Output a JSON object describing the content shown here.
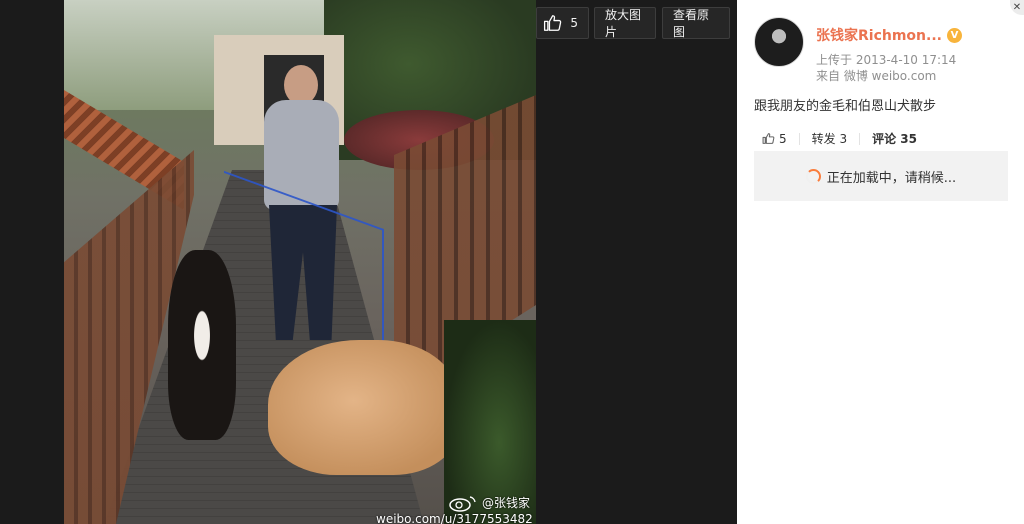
{
  "photo": {
    "watermark_handle": "@张钱家",
    "watermark_url": "weibo.com/u/3177553482"
  },
  "toolbar": {
    "like_count": "5",
    "enlarge_label": "放大图片",
    "original_label": "查看原图"
  },
  "sidebar": {
    "author_name": "张钱家Richmon...",
    "upload_label": "上传于 2013-4-10 17:14",
    "source_prefix": "来自 ",
    "source_app": "微博 weibo.com",
    "post_text": "跟我朋友的金毛和伯恩山犬散步",
    "stats": {
      "like_count": "5",
      "repost_label": "转发 3",
      "comment_label": "评论 35"
    },
    "loading_text": "正在加载中，请稍候..."
  },
  "colors": {
    "author_name": "#eb7350",
    "verified_badge": "#f8b43c",
    "spinner": "#fa7d3c"
  }
}
